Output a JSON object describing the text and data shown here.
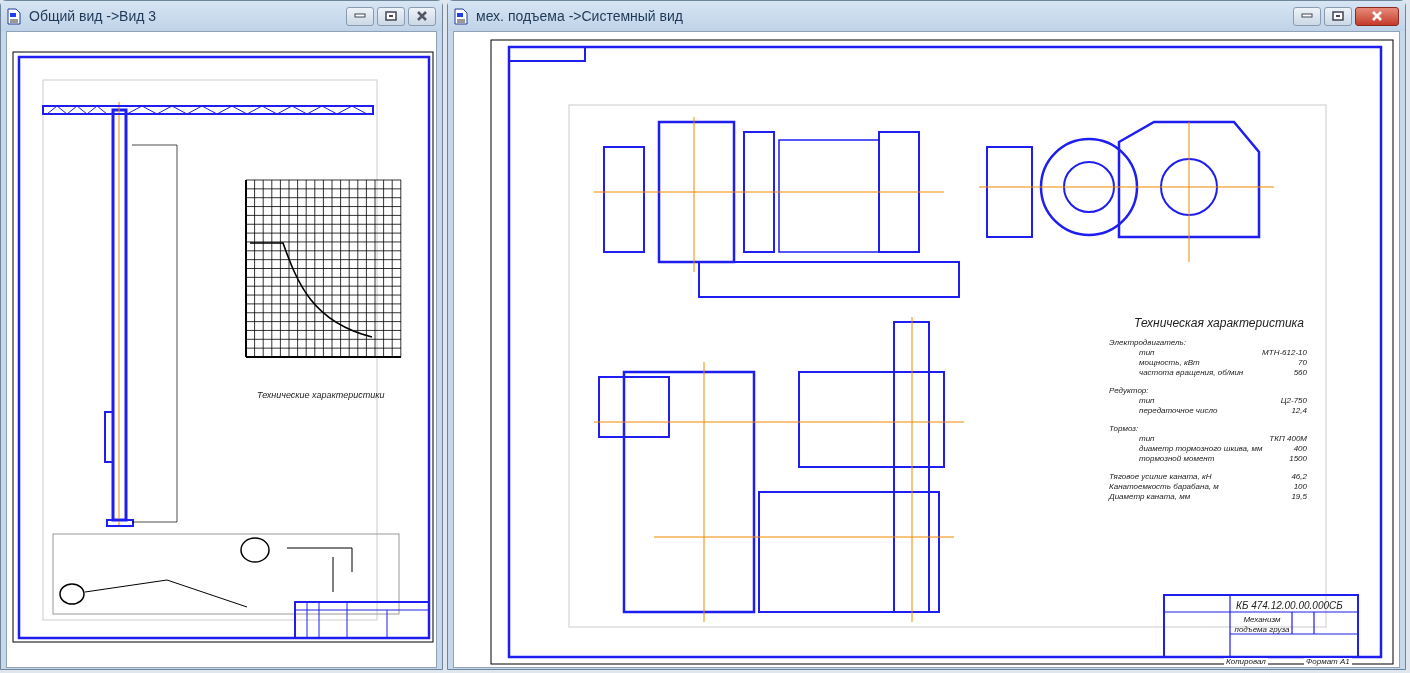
{
  "windows": [
    {
      "title": "Общий вид ->Вид 3",
      "active": false,
      "spec_title": "Технические характеристики"
    },
    {
      "title": "мех. подъема ->Системный вид",
      "active": true,
      "spec_title": "Техническая характеристика",
      "spec_rows": [
        {
          "kind": "group",
          "label": "Электродвигатель:",
          "children": [
            {
              "label": "тип",
              "value": "МТН-612-10"
            },
            {
              "label": "мощность, кВт",
              "value": "70"
            },
            {
              "label": "частота вращения, об/мин",
              "value": "560"
            }
          ]
        },
        {
          "kind": "group",
          "label": "Редуктор:",
          "children": [
            {
              "label": "тип",
              "value": "Ц2-750"
            },
            {
              "label": "передаточное число",
              "value": "12,4"
            }
          ]
        },
        {
          "kind": "group",
          "label": "Тормоз:",
          "children": [
            {
              "label": "тип",
              "value": "ТКП 400М"
            },
            {
              "label": "диаметр тормозного шкива, мм",
              "value": "400"
            },
            {
              "label": "тормозной момент",
              "value": "1500"
            }
          ]
        },
        {
          "kind": "item",
          "label": "Тяговое усилие каната, кН",
          "value": "46,2"
        },
        {
          "kind": "item",
          "label": "Канатоемкость барабана, м",
          "value": "100"
        },
        {
          "kind": "item",
          "label": "Диаметр каната, мм",
          "value": "19,5"
        }
      ],
      "title_block": {
        "designation": "КБ 474.12.00.00.000СБ",
        "name": "Механизм подъема груза"
      },
      "footer": [
        "Копировал",
        "Формат А1"
      ]
    }
  ]
}
